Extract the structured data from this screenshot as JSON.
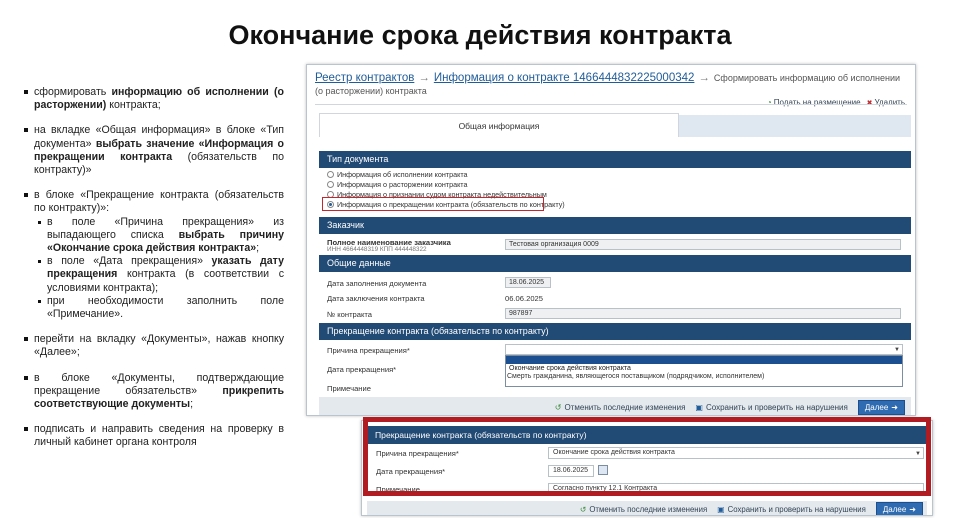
{
  "title": "Окончание срока действия контракта",
  "instructions": {
    "b1": {
      "p1": "сформировать ",
      "b": "информацию об исполнении (о расторжении)",
      "p2": " контракта;"
    },
    "b2": {
      "p1": "на вкладке «Общая информация» в блоке «Тип документа» ",
      "b": "выбрать значение «Информация о прекращении контракта",
      "p2": " (обязательств по контракту)»"
    },
    "b3": {
      "p1": "в блоке «Прекращение контракта (обязательств по контракту)»:"
    },
    "s1": {
      "p1": "в поле «Причина прекращения» из выпадающего списка ",
      "b": "выбрать причину «Окончание срока действия контракта»",
      "p2": ";"
    },
    "s2": {
      "p1": "в поле «Дата прекращения» ",
      "b": "указать дату прекращения",
      "p2": " контракта (в соответствии с условиями контракта);"
    },
    "s3": {
      "p1": "при необходимости заполнить поле «Примечание»."
    },
    "b4": {
      "p1": "перейти на вкладку «Документы», нажав кнопку «Далее»;"
    },
    "b5": {
      "p1": "в блоке «Документы, подтверждающие прекращение обязательств» ",
      "b": "прикрепить соответствующие документы",
      "p2": ";"
    },
    "b6": {
      "p1": "подписать и направить сведения на проверку в личный кабинет органа контроля"
    }
  },
  "screen": {
    "breadcrumb": {
      "registry": "Реестр контрактов",
      "contract_info": "Информация о контракте 1466444832225000342",
      "current": "Сформировать информацию об исполнении (о расторжении) контракта"
    },
    "actions": {
      "publish": "Подать на размещение",
      "delete": "Удалить"
    },
    "tab_general": "Общая информация",
    "doc_type": {
      "header": "Тип документа",
      "options": [
        {
          "label": "Информация об исполнении контракта",
          "selected": false
        },
        {
          "label": "Информация о расторжении контракта",
          "selected": false
        },
        {
          "label": "Информация о признании судом контракта недействительным",
          "selected": false
        },
        {
          "label": "Информация о прекращении контракта (обязательств по контракту)",
          "selected": true
        }
      ]
    },
    "customer": {
      "header": "Заказчик",
      "full_name_label": "Полное наименование заказчика",
      "inn_kpp": "ИНН 4664448319 КПП 444448322",
      "full_name_value": "Тестовая организация 0009"
    },
    "general": {
      "header": "Общие данные",
      "fill_date_label": "Дата заполнения документа",
      "fill_date_value": "18.06.2025",
      "conclusion_date_label": "Дата заключения контракта",
      "conclusion_date_value": "06.06.2025",
      "contract_no_label": "№ контракта",
      "contract_no_value": "987897"
    },
    "termination": {
      "header": "Прекращение контракта (обязательств по контракту)",
      "reason_label": "Причина прекращения*",
      "date_label": "Дата прекращения*",
      "note_label": "Примечание",
      "dropdown_options": [
        "Окончание срока действия контракта",
        "Смерть гражданина, являющегося поставщиком (подрядчиком, исполнителем)"
      ]
    },
    "footer": {
      "cancel_changes": "Отменить последние изменения",
      "save_check": "Сохранить и проверить на нарушения",
      "next": "Далее"
    }
  },
  "inset": {
    "header": "Прекращение контракта (обязательств по контракту)",
    "reason_label": "Причина прекращения*",
    "reason_value": "Окончание срока действия контракта",
    "date_label": "Дата прекращения*",
    "date_value": "18.06.2025",
    "note_label": "Примечание",
    "note_value": "Согласно пункту 12.1 Контракта",
    "footer": {
      "cancel_changes": "Отменить последние изменения",
      "save_check": "Сохранить и проверить на нарушения",
      "next": "Далее"
    }
  },
  "colors": {
    "section_header": "#214a75",
    "highlight_red": "#b01c22",
    "link": "#1f5c99",
    "button": "#2f6bb0"
  }
}
